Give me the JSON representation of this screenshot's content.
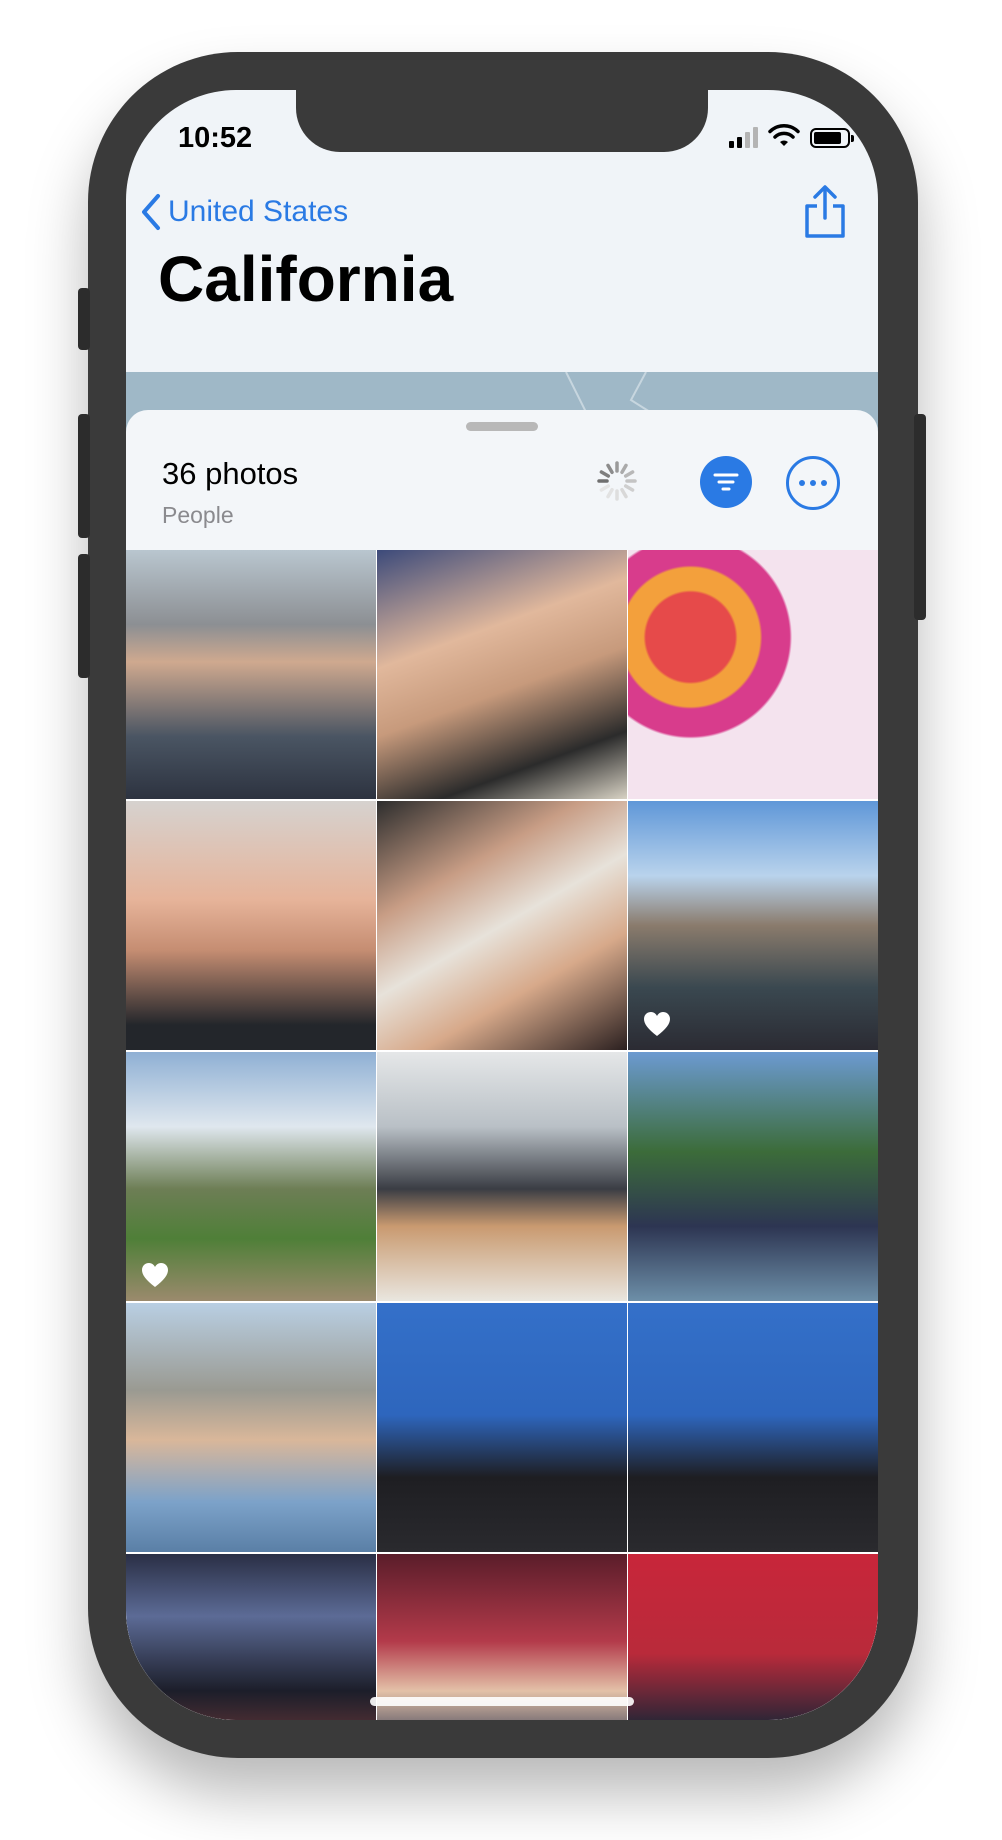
{
  "status_bar": {
    "time": "10:52",
    "signal_bars_active": 2,
    "battery_level": 0.85
  },
  "nav": {
    "back_label": "United States",
    "share_icon": "share-icon"
  },
  "page": {
    "title": "California"
  },
  "sheet": {
    "photo_count": "36 photos",
    "subtitle": "People",
    "loading_icon": "activity-spinner-icon",
    "filter_icon": "filter-icon",
    "more_icon": "ellipsis-icon"
  },
  "colors": {
    "accent": "#2a7ae4",
    "sheet_bg": "#f3f6f9",
    "secondary_text": "#8a8a8e"
  },
  "photos": [
    {
      "favorite": false,
      "scene": "two men selfie outdoors"
    },
    {
      "favorite": false,
      "scene": "woman and teen selfie on plane"
    },
    {
      "favorite": false,
      "scene": "teen in front of colorful mural"
    },
    {
      "favorite": false,
      "scene": "woman and teen selfie at airport"
    },
    {
      "favorite": false,
      "scene": "teen and woman selfie in office"
    },
    {
      "favorite": true,
      "scene": "group selfie under blue sky"
    },
    {
      "favorite": true,
      "scene": "teen standing by cows on trail"
    },
    {
      "favorite": false,
      "scene": "office desk with dog"
    },
    {
      "favorite": false,
      "scene": "teen selfie by river"
    },
    {
      "favorite": false,
      "scene": "teen selfie on beach boardwalk"
    },
    {
      "favorite": false,
      "scene": "seated person blue dropbox shirt"
    },
    {
      "favorite": false,
      "scene": "seated person blue dropbox shirt"
    },
    {
      "favorite": false,
      "scene": "wax museum starship bridge"
    },
    {
      "favorite": false,
      "scene": "teen with wax figure red room"
    },
    {
      "favorite": false,
      "scene": "teen with wax figure in suit"
    }
  ]
}
